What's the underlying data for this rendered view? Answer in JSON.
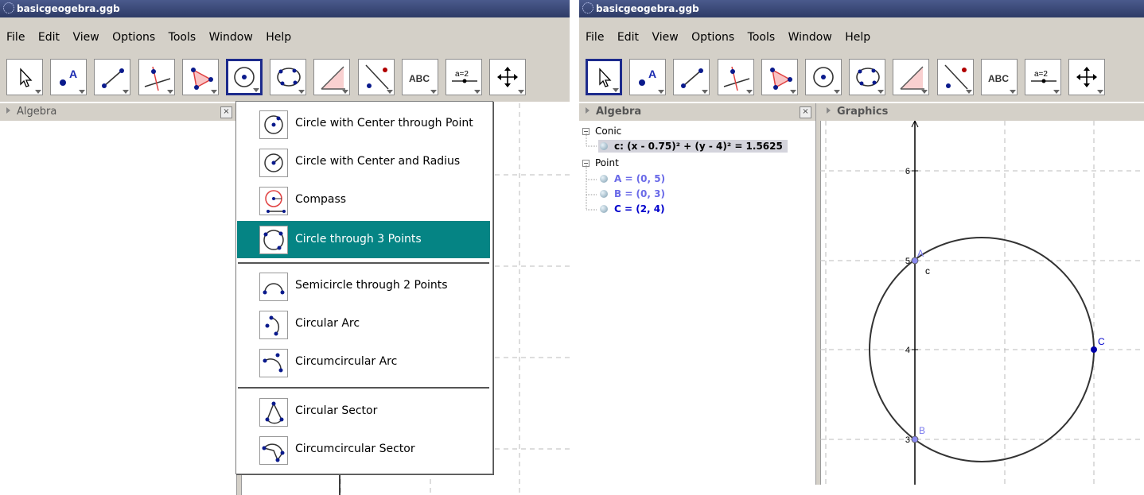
{
  "left": {
    "title": "basicgeogebra.ggb",
    "menu": [
      "File",
      "Edit",
      "View",
      "Options",
      "Tools",
      "Window",
      "Help"
    ],
    "algebra_label": "Algebra",
    "close": "×",
    "dropdown": {
      "items": [
        {
          "label": "Circle with Center through Point"
        },
        {
          "label": "Circle with Center and Radius"
        },
        {
          "label": "Compass"
        },
        {
          "label": "Circle through 3 Points",
          "highlighted": true
        },
        {
          "label": "Semicircle through 2 Points"
        },
        {
          "label": "Circular Arc"
        },
        {
          "label": "Circumcircular Arc"
        },
        {
          "label": "Circular Sector"
        },
        {
          "label": "Circumcircular Sector"
        }
      ]
    }
  },
  "right": {
    "title": "basicgeogebra.ggb",
    "menu": [
      "File",
      "Edit",
      "View",
      "Options",
      "Tools",
      "Window",
      "Help"
    ],
    "algebra_label": "Algebra",
    "graphics_label": "Graphics",
    "close": "×",
    "algebra": {
      "conic_group": "Conic",
      "conic_item": "c: (x - 0.75)² + (y - 4)² = 1.5625",
      "point_group": "Point",
      "points": [
        "A = (0, 5)",
        "B = (0, 3)",
        "C = (2, 4)"
      ]
    },
    "graphics": {
      "y_ticks": [
        "6",
        "5",
        "4",
        "3"
      ],
      "labels": {
        "A": "A",
        "B": "B",
        "C": "C",
        "c": "c"
      }
    }
  },
  "colors": {
    "title_bar": "#3c4a7a",
    "chrome": "#d4d0c8",
    "highlight": "#058484",
    "point_blue": "#0000aa",
    "point_light": "#7a7aee"
  },
  "toolbar_icons": [
    "move-icon",
    "point-icon",
    "line-icon",
    "perpendicular-icon",
    "polygon-icon",
    "circle-icon",
    "conic-icon",
    "angle-icon",
    "reflect-icon",
    "text-icon",
    "slider-icon",
    "move-view-icon"
  ]
}
